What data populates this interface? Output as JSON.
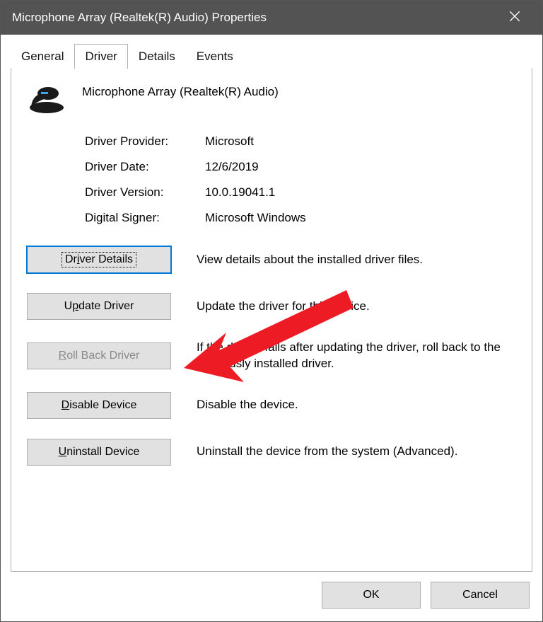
{
  "title": "Microphone Array (Realtek(R) Audio) Properties",
  "tabs": {
    "general": "General",
    "driver": "Driver",
    "details": "Details",
    "events": "Events"
  },
  "device": {
    "name": "Microphone Array (Realtek(R) Audio)"
  },
  "info": {
    "provider_label": "Driver Provider:",
    "provider_value": "Microsoft",
    "date_label": "Driver Date:",
    "date_value": "12/6/2019",
    "version_label": "Driver Version:",
    "version_value": "10.0.19041.1",
    "signer_label": "Digital Signer:",
    "signer_value": "Microsoft Windows"
  },
  "actions": {
    "details": {
      "label_pre": "Dr",
      "label_ul": "i",
      "label_post": "ver Details",
      "desc": "View details about the installed driver files."
    },
    "update": {
      "label_pre": "U",
      "label_ul": "p",
      "label_post": "date Driver",
      "desc": "Update the driver for this device."
    },
    "rollback": {
      "label_pre": "",
      "label_ul": "R",
      "label_post": "oll Back Driver",
      "desc": "If the device fails after updating the driver, roll back to the previously installed driver."
    },
    "disable": {
      "label_pre": "",
      "label_ul": "D",
      "label_post": "isable Device",
      "desc": "Disable the device."
    },
    "uninstall": {
      "label_pre": "",
      "label_ul": "U",
      "label_post": "ninstall Device",
      "desc": "Uninstall the device from the system (Advanced)."
    }
  },
  "footer": {
    "ok": "OK",
    "cancel": "Cancel"
  }
}
